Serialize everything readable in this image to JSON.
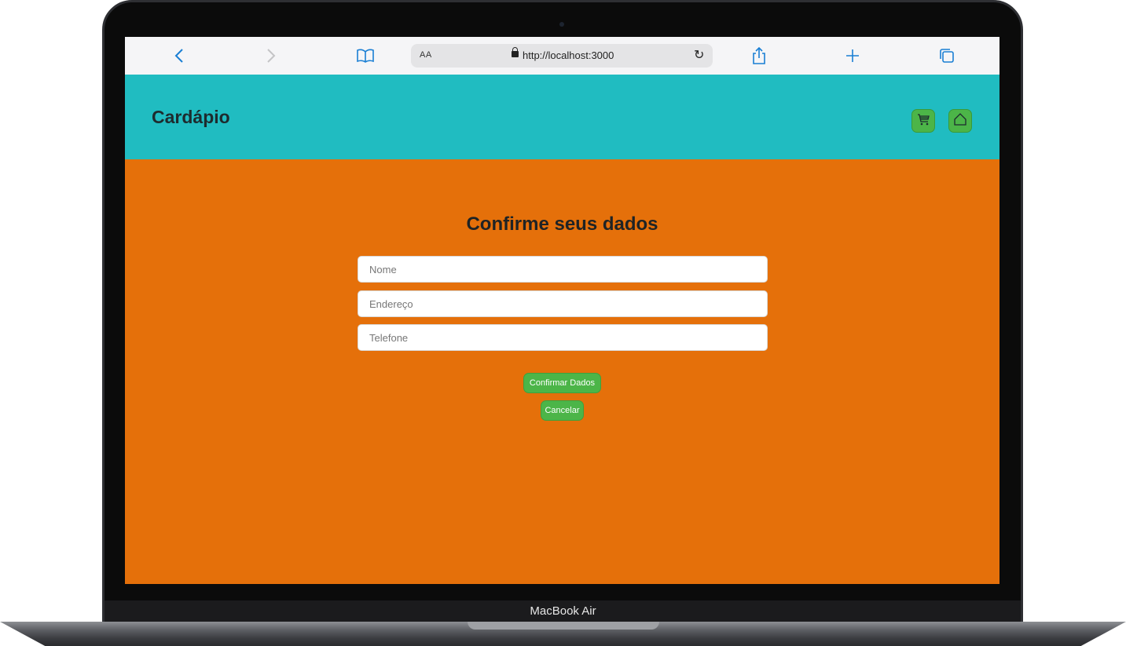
{
  "device": {
    "model_label": "MacBook Air"
  },
  "browser": {
    "back_icon": "chevron-left-icon",
    "forward_icon": "chevron-right-icon",
    "bookmarks_icon": "book-icon",
    "reader_label": "AA",
    "url": "http://localhost:3000",
    "reload_icon": "reload-icon",
    "share_icon": "share-icon",
    "new_tab_icon": "plus-icon",
    "tabs_icon": "tabs-icon"
  },
  "header": {
    "title": "Cardápio",
    "cart_icon": "cart-icon",
    "home_icon": "home-icon"
  },
  "form": {
    "title": "Confirme seus dados",
    "fields": [
      {
        "placeholder": "Nome",
        "value": ""
      },
      {
        "placeholder": "Endereço",
        "value": ""
      },
      {
        "placeholder": "Telefone",
        "value": ""
      }
    ],
    "confirm_label": "Confirmar Dados",
    "cancel_label": "Cancelar"
  },
  "colors": {
    "header_bg": "#20bcc1",
    "page_bg": "#e5700a",
    "button_bg": "#4cb548"
  }
}
